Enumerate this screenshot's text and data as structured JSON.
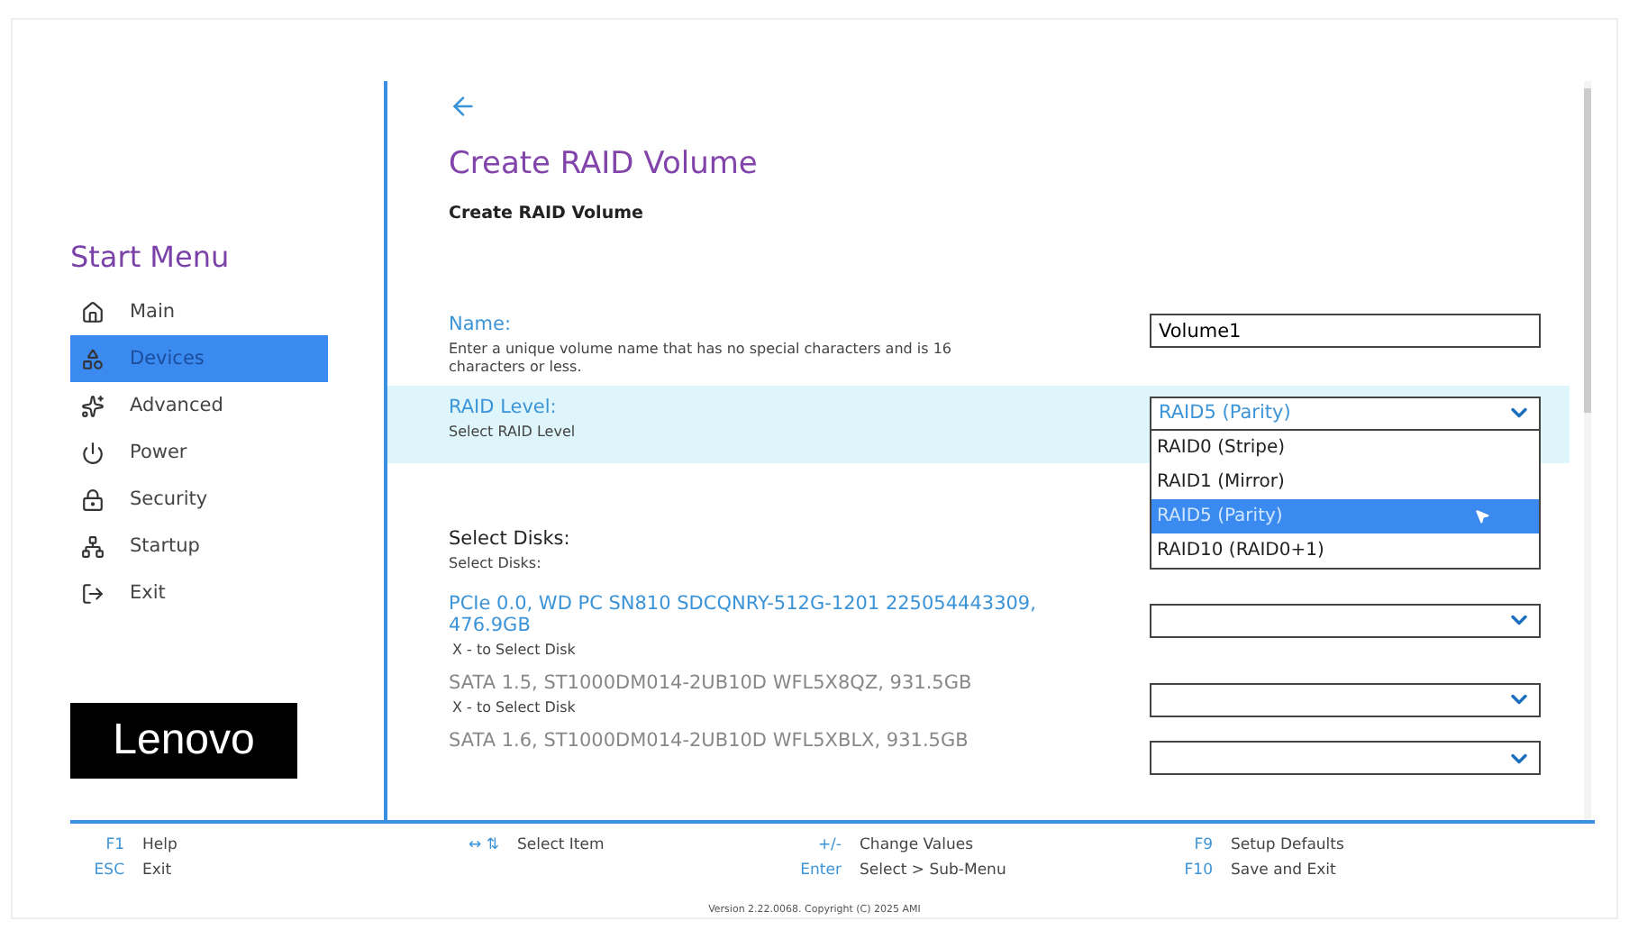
{
  "sidebar": {
    "title": "Start Menu",
    "items": [
      {
        "label": "Main",
        "selected": false
      },
      {
        "label": "Devices",
        "selected": true
      },
      {
        "label": "Advanced",
        "selected": false
      },
      {
        "label": "Power",
        "selected": false
      },
      {
        "label": "Security",
        "selected": false
      },
      {
        "label": "Startup",
        "selected": false
      },
      {
        "label": "Exit",
        "selected": false
      }
    ],
    "logo": "Lenovo"
  },
  "page": {
    "title": "Create RAID Volume",
    "subtitle": "Create RAID Volume",
    "name_field": {
      "label": "Name:",
      "help": "Enter a unique volume name that has no special characters and is 16 characters or less.",
      "value": "Volume1"
    },
    "raid_level": {
      "label": "RAID Level:",
      "help": "Select RAID Level",
      "value": "RAID5 (Parity)",
      "highlighted": true,
      "expanded": true,
      "options": [
        {
          "label": "RAID0 (Stripe)",
          "selected": false
        },
        {
          "label": "RAID1 (Mirror)",
          "selected": false
        },
        {
          "label": "RAID5 (Parity)",
          "selected": true
        },
        {
          "label": "RAID10 (RAID0+1)",
          "selected": false
        }
      ]
    },
    "disks_heading": "Select Disks:",
    "disks_subheading": "Select Disks:",
    "disks": [
      {
        "label": "PCIe 0.0, WD PC SN810 SDCQNRY-512G-1201 225054443309, 476.9GB",
        "help": "X - to Select Disk",
        "focused": true
      },
      {
        "label": "SATA 1.5, ST1000DM014-2UB10D WFL5X8QZ, 931.5GB",
        "help": "X - to Select Disk",
        "focused": false
      },
      {
        "label": "SATA 1.6, ST1000DM014-2UB10D WFL5XBLX, 931.5GB",
        "focused": false
      }
    ]
  },
  "footer": {
    "groups": [
      [
        {
          "key": "F1",
          "action": "Help"
        },
        {
          "key": "ESC",
          "action": "Exit"
        }
      ],
      [
        {
          "key": "↔ ⇅",
          "action": "Select Item"
        }
      ],
      [
        {
          "key": "+/-",
          "action": "Change Values"
        },
        {
          "key": "Enter",
          "action": "Select > Sub-Menu"
        }
      ],
      [
        {
          "key": "F9",
          "action": "Setup Defaults"
        },
        {
          "key": "F10",
          "action": "Save and Exit"
        }
      ]
    ],
    "version": "Version 2.22.0068. Copyright (C) 2025 AMI"
  }
}
